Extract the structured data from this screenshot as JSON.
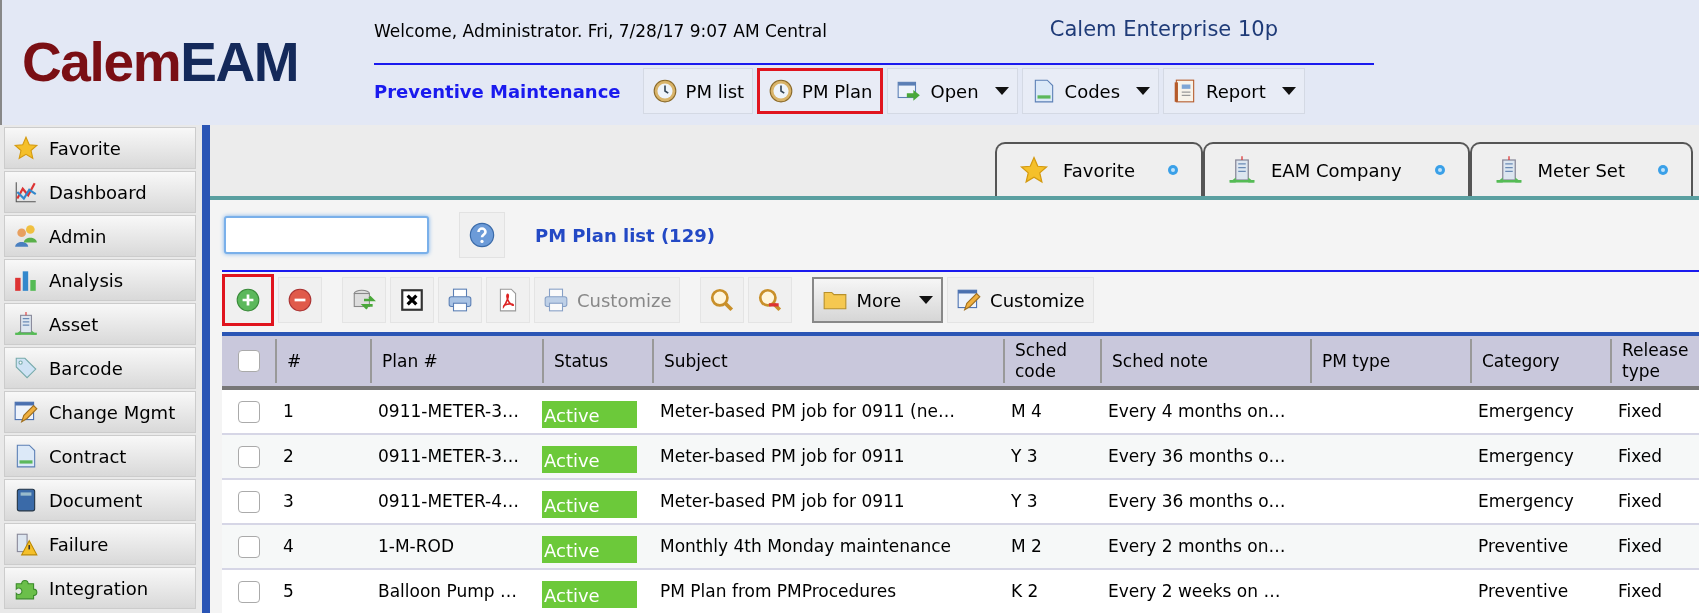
{
  "header": {
    "logo": {
      "part_1": "Calem",
      "part_2": "EAM"
    },
    "welcome": "Welcome, Administrator. Fri, 7/28/17 9:07 AM Central",
    "product": "Calem Enterprise 10p",
    "module": "Preventive Maintenance",
    "module_buttons": [
      {
        "kind": "clock",
        "label": "PM list",
        "dropdown": false,
        "highlighted": false
      },
      {
        "kind": "clock",
        "label": "PM Plan",
        "dropdown": false,
        "highlighted": true
      },
      {
        "kind": "open",
        "label": "Open",
        "dropdown": true,
        "highlighted": false
      },
      {
        "kind": "page",
        "label": "Codes",
        "dropdown": true,
        "highlighted": false
      },
      {
        "kind": "notebook",
        "label": "Report",
        "dropdown": true,
        "highlighted": false
      }
    ]
  },
  "sidebar": {
    "items": [
      {
        "kind": "star",
        "label": "Favorite"
      },
      {
        "kind": "chart",
        "label": "Dashboard"
      },
      {
        "kind": "people",
        "label": "Admin"
      },
      {
        "kind": "bars",
        "label": "Analysis"
      },
      {
        "kind": "building",
        "label": "Asset"
      },
      {
        "kind": "tag",
        "label": "Barcode"
      },
      {
        "kind": "edit",
        "label": "Change Mgmt"
      },
      {
        "kind": "page",
        "label": "Contract"
      },
      {
        "kind": "book",
        "label": "Document"
      },
      {
        "kind": "warning",
        "label": "Failure"
      },
      {
        "kind": "puzzle",
        "label": "Integration"
      }
    ]
  },
  "tabs": [
    {
      "kind": "star",
      "label": "Favorite"
    },
    {
      "kind": "building",
      "label": "EAM Company"
    },
    {
      "kind": "building",
      "label": "Meter Set"
    }
  ],
  "list": {
    "title": "PM Plan list (129)",
    "toolbar": {
      "groups": [
        [
          {
            "kind": "add",
            "highlighted": true,
            "disabled": false,
            "dropdown": false,
            "pressed": false
          },
          {
            "kind": "remove",
            "highlighted": false,
            "disabled": false,
            "dropdown": false,
            "pressed": false
          }
        ],
        [
          {
            "kind": "refresh",
            "highlighted": false,
            "disabled": false,
            "dropdown": false,
            "pressed": false
          },
          {
            "kind": "delete",
            "highlighted": false,
            "disabled": false,
            "dropdown": false,
            "pressed": false
          },
          {
            "kind": "print",
            "highlighted": false,
            "disabled": false,
            "dropdown": false,
            "pressed": false
          },
          {
            "kind": "pdf",
            "highlighted": false,
            "disabled": false,
            "dropdown": false,
            "pressed": false
          },
          {
            "kind": "print",
            "label": "Customize",
            "highlighted": false,
            "disabled": true,
            "dropdown": false,
            "pressed": false
          }
        ],
        [
          {
            "kind": "search",
            "highlighted": false,
            "disabled": false,
            "dropdown": false,
            "pressed": false
          },
          {
            "kind": "clear-search",
            "highlighted": false,
            "disabled": false,
            "dropdown": false,
            "pressed": false
          }
        ],
        [
          {
            "kind": "folder",
            "label": "More",
            "highlighted": false,
            "disabled": false,
            "dropdown": true,
            "pressed": true
          },
          {
            "kind": "edit",
            "label": "Customize",
            "highlighted": false,
            "disabled": false,
            "dropdown": false,
            "pressed": false
          }
        ]
      ]
    },
    "table": {
      "all_checked": false,
      "columns": [
        "#",
        "Plan #",
        "Status",
        "Subject",
        "Sched code",
        "Sched note",
        "PM type",
        "Category",
        "Release type"
      ],
      "rows": [
        {
          "checked": false,
          "cells": [
            "1",
            "0911-METER-3…",
            "Active",
            "Meter-based PM job for 0911 (ne…",
            "M 4",
            "Every 4 months on…",
            "",
            "Emergency",
            "Fixed"
          ]
        },
        {
          "checked": false,
          "cells": [
            "2",
            "0911-METER-3…",
            "Active",
            "Meter-based PM job for 0911",
            "Y 3",
            "Every 36 months o…",
            "",
            "Emergency",
            "Fixed"
          ]
        },
        {
          "checked": false,
          "cells": [
            "3",
            "0911-METER-4…",
            "Active",
            "Meter-based PM job for 0911",
            "Y 3",
            "Every 36 months o…",
            "",
            "Emergency",
            "Fixed"
          ]
        },
        {
          "checked": false,
          "cells": [
            "4",
            "1-M-ROD",
            "Active",
            "Monthly 4th Monday maintenance",
            "M 2",
            "Every 2 months on…",
            "",
            "Preventive",
            "Fixed"
          ]
        },
        {
          "checked": false,
          "cells": [
            "5",
            "Balloon Pump …",
            "Active",
            "PM Plan from PMProcedures",
            "K 2",
            "Every 2 weeks on …",
            "",
            "Preventive",
            "Fixed"
          ]
        }
      ]
    }
  }
}
